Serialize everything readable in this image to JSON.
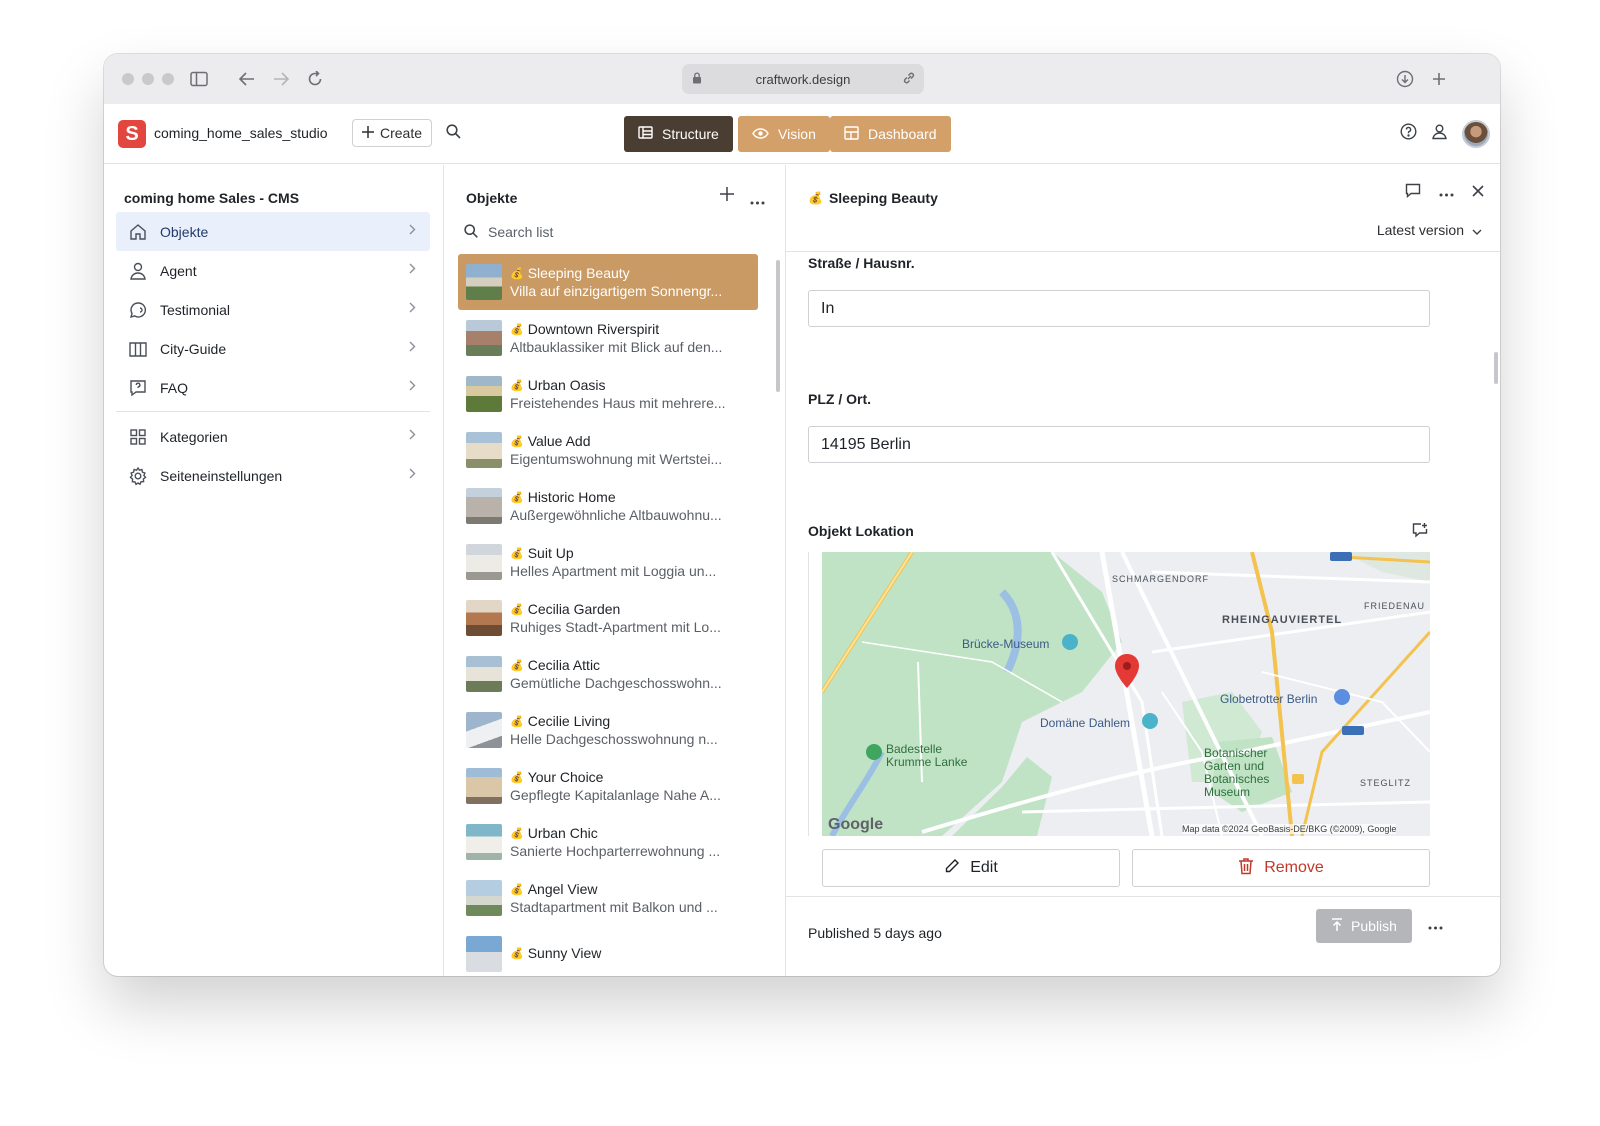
{
  "browser": {
    "url": "craftwork.design"
  },
  "app": {
    "project_name": "coming_home_sales_studio",
    "create_label": "Create"
  },
  "tools": [
    {
      "label": "Structure"
    },
    {
      "label": "Vision"
    },
    {
      "label": "Dashboard"
    }
  ],
  "colors": {
    "accent": "#c99a63",
    "structure_active": "#4a3d31",
    "tool_inactive": "#d4a06a",
    "logo": "#e2463e",
    "remove": "#c0392b",
    "nav_active_bg": "#eaf0fb"
  },
  "sidebar": {
    "title": "coming home Sales - CMS",
    "items": [
      {
        "label": "Objekte",
        "icon": "home-icon",
        "active": true
      },
      {
        "label": "Agent",
        "icon": "user-icon"
      },
      {
        "label": "Testimonial",
        "icon": "chat-icon"
      },
      {
        "label": "City-Guide",
        "icon": "map-icon"
      },
      {
        "label": "FAQ",
        "icon": "help-icon"
      }
    ],
    "items2": [
      {
        "label": "Kategorien",
        "icon": "grid-icon"
      },
      {
        "label": "Seiteneinstellungen",
        "icon": "gear-icon"
      }
    ]
  },
  "list": {
    "title": "Objekte",
    "search_placeholder": "Search list",
    "items": [
      {
        "title": "Sleeping Beauty",
        "subtitle": "Villa auf einzigartigem Sonnengr...",
        "selected": true
      },
      {
        "title": "Downtown Riverspirit",
        "subtitle": "Altbauklassiker mit Blick auf den..."
      },
      {
        "title": "Urban Oasis",
        "subtitle": "Freistehendes Haus mit mehrere..."
      },
      {
        "title": "Value Add",
        "subtitle": "Eigentumswohnung mit Wertstei..."
      },
      {
        "title": "Historic Home",
        "subtitle": "Außergewöhnliche Altbauwohnu..."
      },
      {
        "title": "Suit Up",
        "subtitle": "Helles Apartment mit Loggia un..."
      },
      {
        "title": "Cecilia Garden",
        "subtitle": "Ruhiges Stadt-Apartment mit Lo..."
      },
      {
        "title": "Cecilia Attic",
        "subtitle": "Gemütliche Dachgeschosswohn..."
      },
      {
        "title": "Cecilie Living",
        "subtitle": "Helle Dachgeschosswohnung n..."
      },
      {
        "title": "Your Choice",
        "subtitle": "Gepflegte Kapitalanlage Nahe A..."
      },
      {
        "title": "Urban Chic",
        "subtitle": "Sanierte Hochparterrewohnung ..."
      },
      {
        "title": "Angel View",
        "subtitle": "Stadtapartment mit Balkon und ..."
      },
      {
        "title": "Sunny View",
        "subtitle": ""
      }
    ]
  },
  "document": {
    "title": "Sleeping Beauty",
    "version_label": "Latest version",
    "fields": {
      "street_label": "Straße / Hausnr.",
      "street_value": "In",
      "plz_label": "PLZ / Ort.",
      "plz_value": "14195 Berlin",
      "location_label": "Objekt Lokation"
    },
    "map": {
      "labels": {
        "schmargendorf": "SCHMARGENDORF",
        "friedenau": "FRIEDENAU",
        "rheingauviertel": "RHEINGAUVIERTEL",
        "bruecke": "Brücke-Museum",
        "globetrotter": "Globetrotter Berlin",
        "domaene": "Domäne Dahlem",
        "badestelle": "Badestelle Krumme Lanke",
        "botanischer": "Botanischer Garten und Botanisches Museum",
        "steglitz": "STEGLITZ",
        "google": "Google",
        "attribution": "Map data ©2024 GeoBasis-DE/BKG (©2009), Google"
      }
    },
    "edit_label": "Edit",
    "remove_label": "Remove",
    "status": "Published 5 days ago",
    "publish_label": "Publish"
  }
}
